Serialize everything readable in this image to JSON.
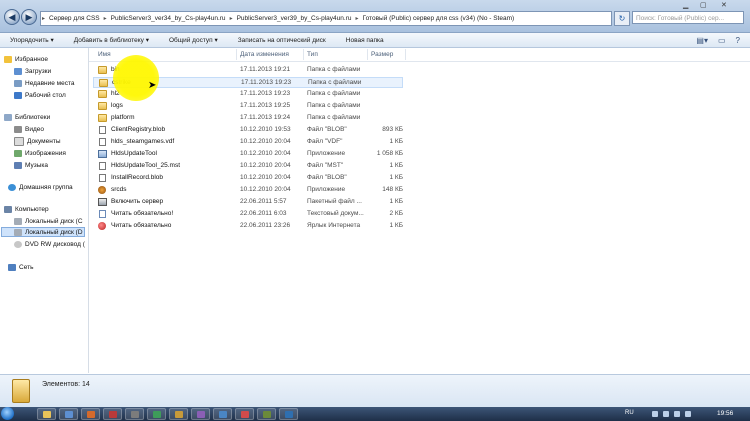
{
  "address": {
    "crumbs": [
      "Сервер для CSS",
      "PublicServer3_ver34_by_Cs-play4un.ru",
      "PublicServer3_ver39_by_Cs-play4un.ru",
      "Готовый (Public) сервер для css (v34) (No - Steam)"
    ],
    "search_placeholder": "Поиск: Готовый (Public) сер..."
  },
  "toolbar": {
    "items": [
      "Упорядочить ▾",
      "Добавить в библиотеку ▾",
      "Общий доступ ▾",
      "Записать на оптический диск",
      "Новая папка"
    ]
  },
  "nav": {
    "favorites": "Избранное",
    "downloads": "Загрузки",
    "recent": "Недавние места",
    "desktop": "Рабочий стол",
    "libraries": "Библиотеки",
    "video": "Видео",
    "documents": "Документы",
    "images": "Изображения",
    "music": "Музыка",
    "homegroup": "Домашняя группа",
    "computer": "Компьютер",
    "disk_c": "Локальный диск (C",
    "disk_d": "Локальный диск (D",
    "dvd": "DVD RW дисковод (",
    "network": "Сеть"
  },
  "columns": {
    "name": "Имя",
    "date": "Дата изменения",
    "type": "Тип",
    "size": "Размер"
  },
  "files": [
    {
      "name": "bin",
      "date": "17.11.2013 19:21",
      "type": "Папка с файлами",
      "size": "",
      "icon": "folder-icon"
    },
    {
      "name": "cstrike",
      "date": "17.11.2013 19:23",
      "type": "Папка с файлами",
      "size": "",
      "icon": "folder-icon"
    },
    {
      "name": "hl2",
      "date": "17.11.2013 19:23",
      "type": "Папка с файлами",
      "size": "",
      "icon": "folder-icon"
    },
    {
      "name": "logs",
      "date": "17.11.2013 19:25",
      "type": "Папка с файлами",
      "size": "",
      "icon": "folder-icon"
    },
    {
      "name": "platform",
      "date": "17.11.2013 19:24",
      "type": "Папка с файлами",
      "size": "",
      "icon": "folder-icon"
    },
    {
      "name": "ClientRegistry.blob",
      "date": "10.12.2010 19:53",
      "type": "Файл \"BLOB\"",
      "size": "893 КБ",
      "icon": "file-icon"
    },
    {
      "name": "hlds_steamgames.vdf",
      "date": "10.12.2010 20:04",
      "type": "Файл \"VDF\"",
      "size": "1 КБ",
      "icon": "file-icon"
    },
    {
      "name": "HldsUpdateTool",
      "date": "10.12.2010 20:04",
      "type": "Приложение",
      "size": "1 058 КБ",
      "icon": "app-icon"
    },
    {
      "name": "HldsUpdateTool_25.mst",
      "date": "10.12.2010 20:04",
      "type": "Файл \"MST\"",
      "size": "1 КБ",
      "icon": "file-icon"
    },
    {
      "name": "InstallRecord.blob",
      "date": "10.12.2010 20:04",
      "type": "Файл \"BLOB\"",
      "size": "1 КБ",
      "icon": "file-icon"
    },
    {
      "name": "srcds",
      "date": "10.12.2010 20:04",
      "type": "Приложение",
      "size": "148 КБ",
      "icon": "steam-icon"
    },
    {
      "name": "Включить сервер",
      "date": "22.06.2011 5:57",
      "type": "Пакетный файл ...",
      "size": "1 КБ",
      "icon": "batch-icon"
    },
    {
      "name": "Читать обязательно!",
      "date": "22.06.2011 6:03",
      "type": "Текстовый докум...",
      "size": "2 КБ",
      "icon": "text-icon"
    },
    {
      "name": "Читать обязательно",
      "date": "22.06.2011 23:26",
      "type": "Ярлык Интернета",
      "size": "1 КБ",
      "icon": "url-icon"
    }
  ],
  "status": {
    "count": "Элементов: 14"
  },
  "taskbar": {
    "lang": "RU",
    "time": "19:56"
  }
}
